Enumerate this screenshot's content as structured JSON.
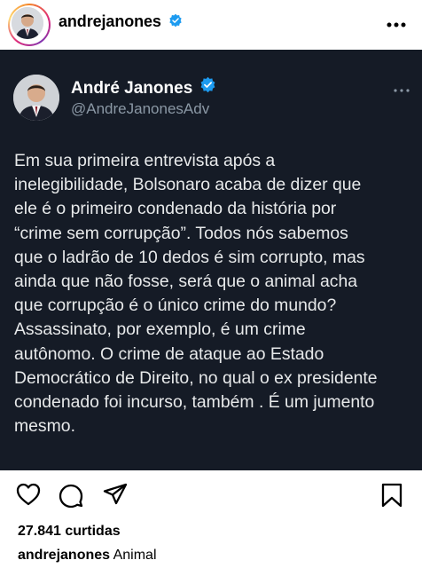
{
  "post": {
    "username": "andrejanones"
  },
  "icons": {
    "verified": "verified-badge-icon",
    "more": "more-options-icon",
    "like": "heart-icon",
    "comment": "comment-icon",
    "share": "send-icon",
    "save": "bookmark-icon"
  },
  "tweet": {
    "name": "André Janones",
    "handle": "@AndreJanonesAdv",
    "text": "Em sua primeira entrevista após a\ninelegibilidade, Bolsonaro acaba de dizer que\nele é o primeiro condenado da história por\n“crime sem corrupção”. Todos nós sabemos\nque o ladrão de 10 dedos é sim corrupto, mas\nainda que não fosse, será  que o animal acha\nque corrupção é o único crime do mundo?\nAssassinato, por exemplo, é um crime\nautônomo. O crime de ataque ao Estado\nDemocrático de Direito, no qual o ex presidente\ncondenado foi incurso, também . É um jumento\nmesmo."
  },
  "likes": "27.841 curtidas",
  "caption": {
    "username": "andrejanones",
    "text": "Animal"
  },
  "colors": {
    "verified": "#1d9bf0",
    "tweet_bg": "#151b26",
    "handle": "#8b98a5"
  }
}
